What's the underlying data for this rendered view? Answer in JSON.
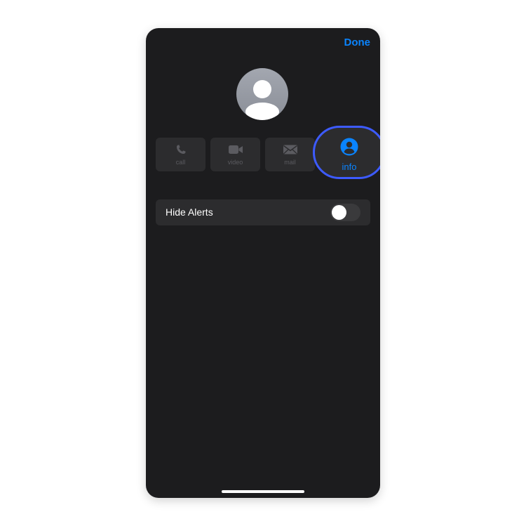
{
  "header": {
    "done_label": "Done"
  },
  "actions": {
    "call": {
      "label": "call",
      "icon": "phone-icon"
    },
    "video": {
      "label": "video",
      "icon": "video-camera-icon"
    },
    "mail": {
      "label": "mail",
      "icon": "envelope-icon"
    },
    "info": {
      "label": "info",
      "icon": "person-circle-icon"
    }
  },
  "settings": {
    "hide_alerts": {
      "label": "Hide Alerts",
      "enabled": false
    }
  },
  "colors": {
    "accent": "#0a84ff",
    "highlight_ring": "#3d5bff",
    "background": "#1c1c1e",
    "cell": "#2c2c2e"
  }
}
